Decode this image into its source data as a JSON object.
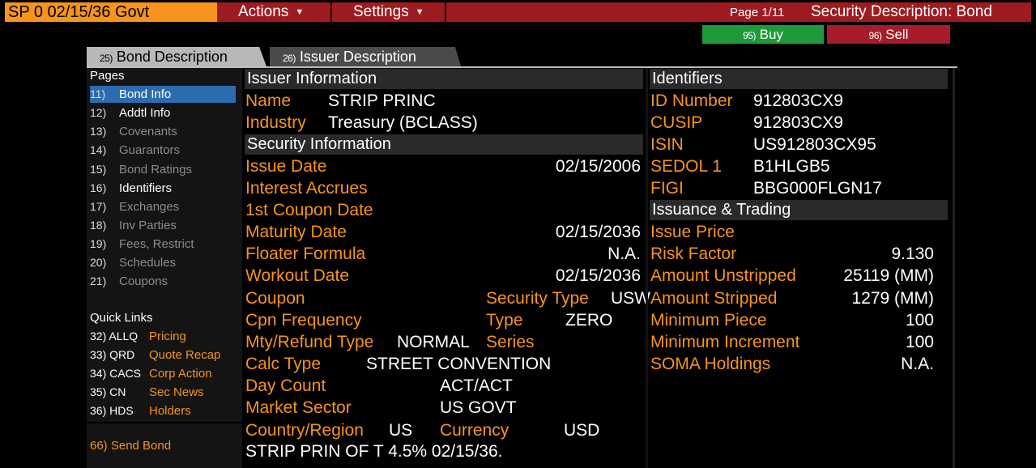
{
  "header": {
    "ticker": "SP 0 02/15/36 Govt",
    "actions": "Actions",
    "settings": "Settings",
    "page": "Page 1/11",
    "title": "Security Description: Bond",
    "buy_num": "95)",
    "buy": "Buy",
    "sell_num": "96)",
    "sell": "Sell"
  },
  "tabs": [
    {
      "num": "25)",
      "label": "Bond Description"
    },
    {
      "num": "26)",
      "label": "Issuer Description"
    }
  ],
  "sidebar": {
    "heading": "Pages",
    "items": [
      {
        "num": "11)",
        "label": "Bond Info"
      },
      {
        "num": "12)",
        "label": "Addtl Info"
      },
      {
        "num": "13)",
        "label": "Covenants"
      },
      {
        "num": "14)",
        "label": "Guarantors"
      },
      {
        "num": "15)",
        "label": "Bond Ratings"
      },
      {
        "num": "16)",
        "label": "Identifiers"
      },
      {
        "num": "17)",
        "label": "Exchanges"
      },
      {
        "num": "18)",
        "label": "Inv Parties"
      },
      {
        "num": "19)",
        "label": "Fees, Restrict"
      },
      {
        "num": "20)",
        "label": "Schedules"
      },
      {
        "num": "21)",
        "label": "Coupons"
      }
    ],
    "quick_heading": "Quick Links",
    "quick": [
      {
        "code": "32) ALLQ",
        "label": "Pricing"
      },
      {
        "code": "33) QRD",
        "label": "Quote Recap"
      },
      {
        "code": "34) CACS",
        "label": "Corp Action"
      },
      {
        "code": "35) CN",
        "label": "Sec News"
      },
      {
        "code": "36) HDS",
        "label": "Holders"
      }
    ],
    "send": "66) Send Bond"
  },
  "issuer": {
    "heading": "Issuer Information",
    "name_label": "Name",
    "name": "STRIP PRINC",
    "industry_label": "Industry",
    "industry": "Treasury (BCLASS)"
  },
  "security": {
    "heading": "Security Information",
    "issue_date_label": "Issue Date",
    "issue_date": "02/15/2006",
    "interest_accrues_label": "Interest Accrues",
    "first_coupon_label": "1st Coupon Date",
    "maturity_label": "Maturity Date",
    "maturity": "02/15/2036",
    "floater_label": "Floater Formula",
    "floater": "N.A.",
    "workout_label": "Workout Date",
    "workout": "02/15/2036",
    "coupon_label": "Coupon",
    "sec_type_label": "Security Type",
    "sec_type": "USW",
    "cpn_freq_label": "Cpn Frequency",
    "type_label": "Type",
    "type": "ZERO",
    "mty_label": "Mty/Refund Type",
    "mty": "NORMAL",
    "series_label": "Series",
    "calc_label": "Calc Type",
    "calc": "STREET CONVENTION",
    "daycount_label": "Day Count",
    "daycount": "ACT/ACT",
    "sector_label": "Market Sector",
    "sector": "US GOVT",
    "country_label": "Country/Region",
    "country": "US",
    "currency_label": "Currency",
    "currency": "USD",
    "description": "STRIP PRIN OF T 4.5% 02/15/36."
  },
  "identifiers": {
    "heading": "Identifiers",
    "id_label": "ID Number",
    "id": "912803CX9",
    "cusip_label": "CUSIP",
    "cusip": "912803CX9",
    "isin_label": "ISIN",
    "isin": "US912803CX95",
    "sedol_label": "SEDOL 1",
    "sedol": "B1HLGB5",
    "figi_label": "FIGI",
    "figi": "BBG000FLGN17"
  },
  "issuance": {
    "heading": "Issuance & Trading",
    "issue_price_label": "Issue Price",
    "risk_label": "Risk Factor",
    "risk": "9.130",
    "unstripped_label": "Amount Unstripped",
    "unstripped": "25119 (MM)",
    "stripped_label": "Amount Stripped",
    "stripped": "1279 (MM)",
    "min_piece_label": "Minimum Piece",
    "min_piece": "100",
    "min_incr_label": "Minimum Increment",
    "min_incr": "100",
    "soma_label": "SOMA Holdings",
    "soma": "N.A."
  }
}
